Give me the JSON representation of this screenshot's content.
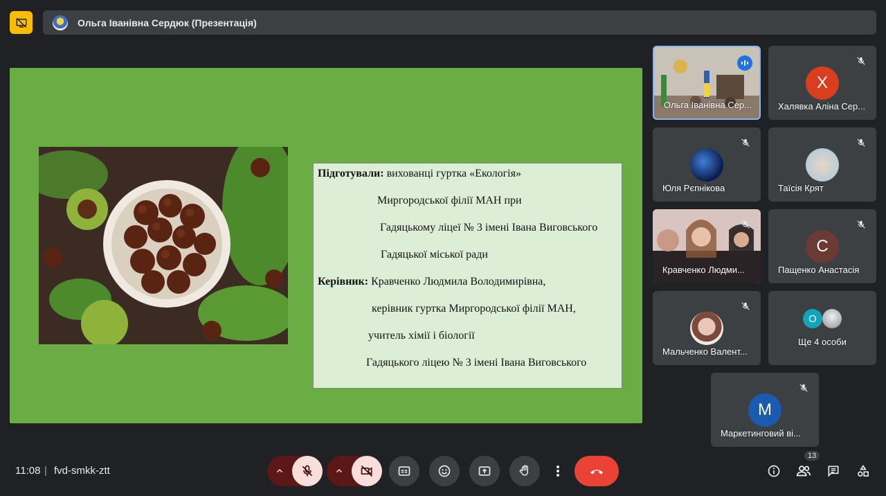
{
  "presenter": {
    "name": "Ольга Іванівна Сердюк (Презентація)"
  },
  "slide": {
    "lines": [
      {
        "bold": "Підготували:",
        "text": " вихованці гуртка «Екологія»"
      },
      {
        "bold": "",
        "text": "Миргородської філії МАН при"
      },
      {
        "bold": "",
        "text": "Гадяцькому ліцеї № 3 імені Івана  Виговського"
      },
      {
        "bold": "",
        "text": "Гадяцької міської ради"
      },
      {
        "bold": "Керівник:",
        "text": " Кравченко Людмила Володимирівна,"
      },
      {
        "bold": "",
        "text": "керівник гуртка Миргородської філії МАН,"
      },
      {
        "bold": "",
        "text": "учитель хімії і біології"
      },
      {
        "bold": "",
        "text": "Гадяцького ліцею № 3 імені Івана  Виговського"
      }
    ]
  },
  "participants": [
    {
      "name": "Ольга Іванівна Сер...",
      "type": "video",
      "speaking": true
    },
    {
      "name": "Халявка Аліна Сер...",
      "letter": "Х",
      "color": "#d93f1f",
      "muted": true
    },
    {
      "name": "Юля Рєпнікова",
      "type": "image",
      "muted": true
    },
    {
      "name": "Таїсія Крят",
      "type": "image",
      "muted": true
    },
    {
      "name": "Кравченко Людми...",
      "type": "video",
      "muted": true
    },
    {
      "name": "Пащенко Анастасія",
      "letter": "С",
      "color": "#6b3a33",
      "muted": true
    },
    {
      "name": "Мальченко Валент...",
      "type": "image",
      "muted": true
    },
    {
      "name": "Ще 4 особи",
      "letter": "О",
      "color": "#12a4b8"
    },
    {
      "name": "Маркетинговий ві...",
      "letter": "М",
      "color": "#1a5bb0",
      "muted": true
    }
  ],
  "bottom": {
    "time": "11:08",
    "separator": "|",
    "meeting_code": "fvd-smkk-ztt",
    "people_count": "13"
  },
  "icons": {
    "present": "present-off-icon",
    "mic": "mic-off-icon",
    "camera": "camera-off-icon",
    "captions": "captions-icon",
    "emoji": "emoji-icon",
    "share": "present-screen-icon",
    "hand": "raise-hand-icon",
    "more": "more-vert-icon",
    "end": "end-call-icon",
    "info": "info-icon",
    "people": "people-icon",
    "chat": "chat-icon",
    "activities": "activities-icon"
  },
  "colors": {
    "background": "#202124",
    "slide_green": "#6bad45",
    "end_call": "#ea4335",
    "present_badge": "#fbbc04",
    "speaking_blue": "#1a73e8"
  }
}
